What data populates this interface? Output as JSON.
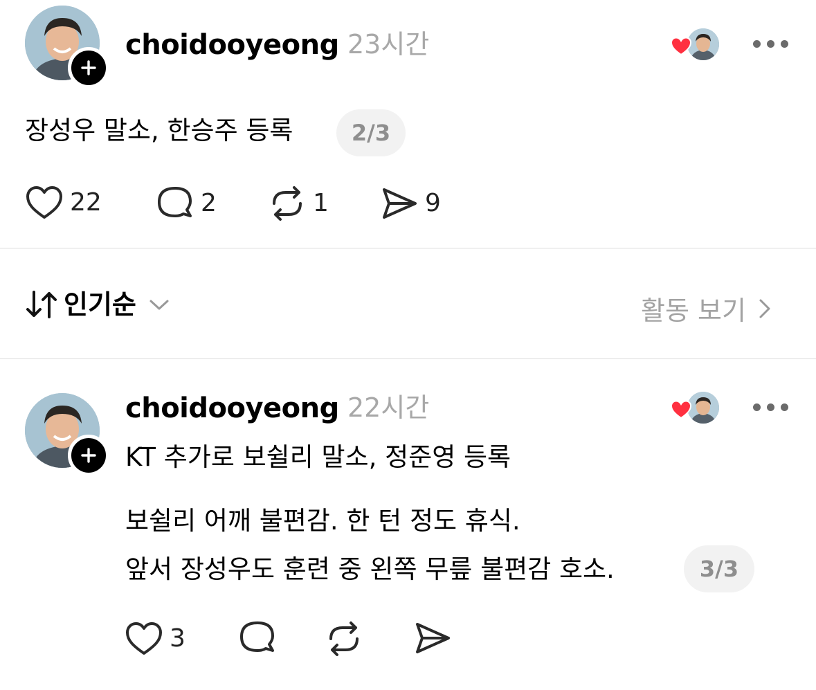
{
  "posts": [
    {
      "username": "choidooyeong",
      "time": "23시간",
      "lines": [
        "장성우 말소, 한승주 등록"
      ],
      "page": "2/3",
      "actions": {
        "likes": "22",
        "comments": "2",
        "reposts": "1",
        "shares": "9"
      }
    },
    {
      "username": "choidooyeong",
      "time": "22시간",
      "lines": [
        "KT 추가로 보쉴리 말소, 정준영 등록",
        "보쉴리 어깨 불편감. 한 턴 정도 휴식.",
        "앞서 장성우도 훈련 중 왼쪽 무릎 불편감 호소."
      ],
      "page": "3/3",
      "actions": {
        "likes": "3"
      }
    }
  ],
  "sort_bar": {
    "label": "인기순",
    "activity_label": "활동 보기"
  },
  "icons": {
    "follow": "plus-icon",
    "liked_by": "heart-icon",
    "more": "more-icon",
    "like": "heart-outline-icon",
    "comment": "comment-icon",
    "repost": "repost-icon",
    "share": "send-icon",
    "sort": "sort-arrows-icon",
    "dropdown": "chevron-down-icon",
    "activity": "chevron-right-icon"
  },
  "colors": {
    "heart_red": "#ff3040",
    "muted_text": "#a8a8a8",
    "pill_bg": "#f2f2f2"
  }
}
